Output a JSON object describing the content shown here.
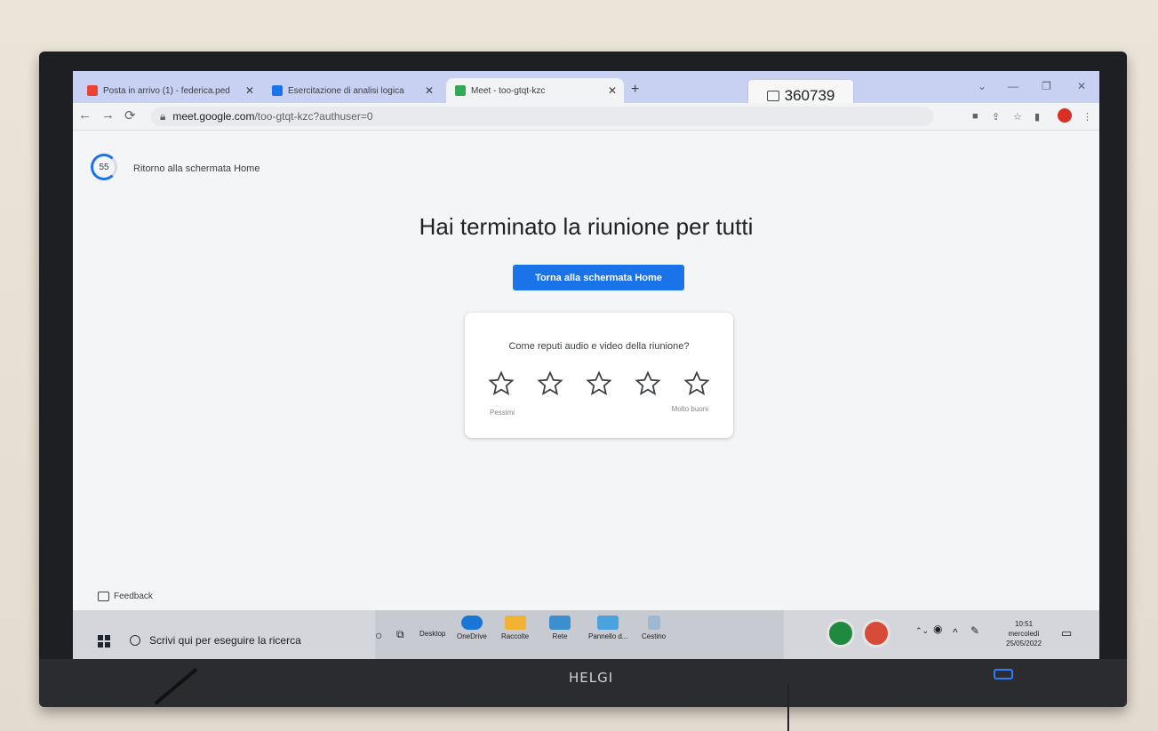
{
  "browser": {
    "tabs": [
      {
        "label": "Posta in arrivo (1) - federica.ped",
        "close": "✕"
      },
      {
        "label": "Esercitazione di analisi logica",
        "close": "✕"
      },
      {
        "label": "Meet - too-gtqt-kzc",
        "close": "✕"
      }
    ],
    "new_tab": "+",
    "meeting_code": "360739",
    "url_host": "meet.google.com",
    "url_path": "/too-gtqt-kzc?authuser=0",
    "profile_initial": "F",
    "window_controls": [
      "⌄",
      "—",
      "❐",
      "✕"
    ]
  },
  "page": {
    "countdown": "55",
    "return_text": "Ritorno alla schermata Home",
    "title": "Hai terminato la riunione per tutti",
    "home_button": "Torna alla schermata Home",
    "rating": {
      "question": "Come reputi audio e video della riunione?",
      "stars": 5,
      "low_label": "Pessimi",
      "high_label": "Molto buoni"
    },
    "feedback": "Feedback"
  },
  "taskbar": {
    "search_placeholder": "Scrivi qui per eseguire la ricerca",
    "desktop": "Desktop",
    "items": [
      "OneDrive",
      "Raccolte",
      "Rete",
      "Pannello d...",
      "Cestino"
    ],
    "clock_time": "10:51",
    "clock_day": "mercoledì",
    "clock_date": "25/05/2022"
  },
  "device": {
    "brand": "HELGI"
  }
}
